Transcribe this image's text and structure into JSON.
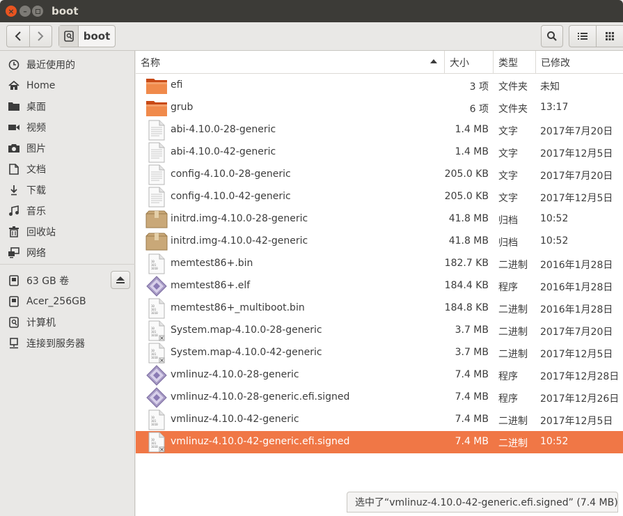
{
  "window": {
    "title": "boot"
  },
  "toolbar": {
    "path_label": "boot"
  },
  "sidebar": {
    "items": [
      {
        "label": "最近使用的",
        "icon": "clock-icon"
      },
      {
        "label": "Home",
        "icon": "home-icon"
      },
      {
        "label": "桌面",
        "icon": "folder-icon"
      },
      {
        "label": "视频",
        "icon": "video-icon"
      },
      {
        "label": "图片",
        "icon": "camera-icon"
      },
      {
        "label": "文档",
        "icon": "document-icon"
      },
      {
        "label": "下载",
        "icon": "download-icon"
      },
      {
        "label": "音乐",
        "icon": "music-icon"
      },
      {
        "label": "回收站",
        "icon": "trash-icon"
      },
      {
        "label": "网络",
        "icon": "network-icon"
      }
    ],
    "devices": [
      {
        "label": "63 GB 卷",
        "icon": "drive-icon"
      },
      {
        "label": "Acer_256GB",
        "icon": "drive-icon"
      },
      {
        "label": "计算机",
        "icon": "computer-icon"
      },
      {
        "label": "连接到服务器",
        "icon": "server-icon"
      }
    ]
  },
  "columns": {
    "name": "名称",
    "size": "大小",
    "type": "类型",
    "modified": "已修改"
  },
  "files": [
    {
      "name": "efi",
      "size": "3 项",
      "type": "文件夹",
      "modified": "未知",
      "icon": "folder"
    },
    {
      "name": "grub",
      "size": "6 项",
      "type": "文件夹",
      "modified": "13:17",
      "icon": "folder"
    },
    {
      "name": "abi-4.10.0-28-generic",
      "size": "1.4 MB",
      "type": "文字",
      "modified": "2017年7月20日",
      "icon": "text"
    },
    {
      "name": "abi-4.10.0-42-generic",
      "size": "1.4 MB",
      "type": "文字",
      "modified": "2017年12月5日",
      "icon": "text"
    },
    {
      "name": "config-4.10.0-28-generic",
      "size": "205.0 KB",
      "type": "文字",
      "modified": "2017年7月20日",
      "icon": "text"
    },
    {
      "name": "config-4.10.0-42-generic",
      "size": "205.0 KB",
      "type": "文字",
      "modified": "2017年12月5日",
      "icon": "text"
    },
    {
      "name": "initrd.img-4.10.0-28-generic",
      "size": "41.8 MB",
      "type": "归档",
      "modified": "10:52",
      "icon": "archive"
    },
    {
      "name": "initrd.img-4.10.0-42-generic",
      "size": "41.8 MB",
      "type": "归档",
      "modified": "10:52",
      "icon": "archive"
    },
    {
      "name": "memtest86+.bin",
      "size": "182.7 KB",
      "type": "二进制",
      "modified": "2016年1月28日",
      "icon": "binary"
    },
    {
      "name": "memtest86+.elf",
      "size": "184.4 KB",
      "type": "程序",
      "modified": "2016年1月28日",
      "icon": "program"
    },
    {
      "name": "memtest86+_multiboot.bin",
      "size": "184.8 KB",
      "type": "二进制",
      "modified": "2016年1月28日",
      "icon": "binary"
    },
    {
      "name": "System.map-4.10.0-28-generic",
      "size": "3.7 MB",
      "type": "二进制",
      "modified": "2017年7月20日",
      "icon": "binary-x"
    },
    {
      "name": "System.map-4.10.0-42-generic",
      "size": "3.7 MB",
      "type": "二进制",
      "modified": "2017年12月5日",
      "icon": "binary-x"
    },
    {
      "name": "vmlinuz-4.10.0-28-generic",
      "size": "7.4 MB",
      "type": "程序",
      "modified": "2017年12月28日",
      "icon": "program"
    },
    {
      "name": "vmlinuz-4.10.0-28-generic.efi.signed",
      "size": "7.4 MB",
      "type": "程序",
      "modified": "2017年12月26日",
      "icon": "program"
    },
    {
      "name": "vmlinuz-4.10.0-42-generic",
      "size": "7.4 MB",
      "type": "二进制",
      "modified": "2017年12月5日",
      "icon": "binary"
    },
    {
      "name": "vmlinuz-4.10.0-42-generic.efi.signed",
      "size": "7.4 MB",
      "type": "二进制",
      "modified": "10:52",
      "icon": "binary-x",
      "selected": true
    }
  ],
  "status": {
    "text": "选中了“vmlinuz-4.10.0-42-generic.efi.signed” (7.4 MB)"
  },
  "colors": {
    "accent": "#f07746",
    "titlebar": "#3c3b37",
    "close": "#e95420"
  }
}
